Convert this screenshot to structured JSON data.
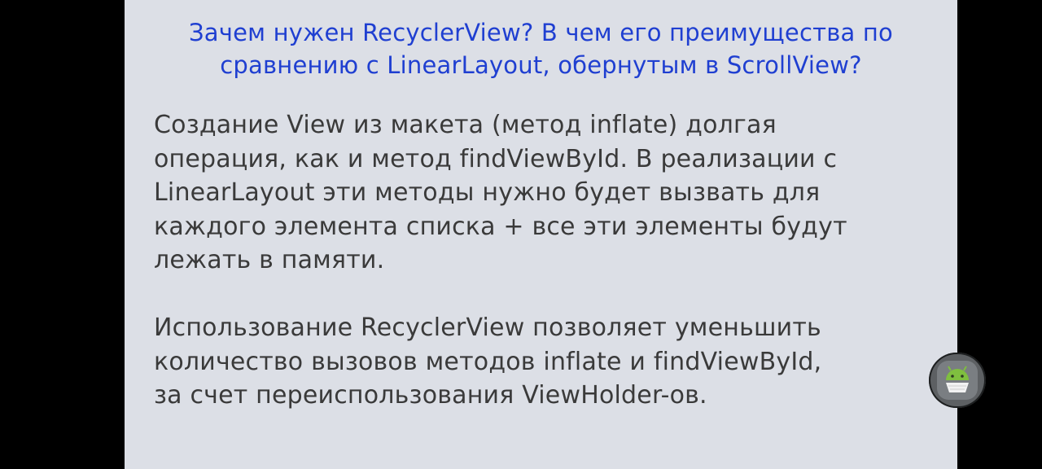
{
  "question": {
    "line1": "Зачем нужен RecyclerView? В чем его преимущества по",
    "line2": "сравнению с LinearLayout, обернутым в ScrollView?"
  },
  "answer": {
    "paragraph1": [
      "Создание View из макета (метод inflate) долгая",
      "операция, как и метод findViewById. В реализации с",
      "LinearLayout эти методы нужно будет вызвать для",
      "каждого элемента списка + все эти элементы будут",
      "лежать в памяти."
    ],
    "paragraph2": [
      "Использование RecyclerView позволяет уменьшить",
      "количество вызовов методов inflate и findViewById,",
      "за счет переиспользования ViewHolder-ов."
    ]
  },
  "colors": {
    "background": "#000000",
    "card": "#dcdfe6",
    "question_text": "#1f3fd1",
    "answer_text": "#3a3a3a"
  },
  "floating_button": {
    "icon": "android-robot-icon"
  }
}
